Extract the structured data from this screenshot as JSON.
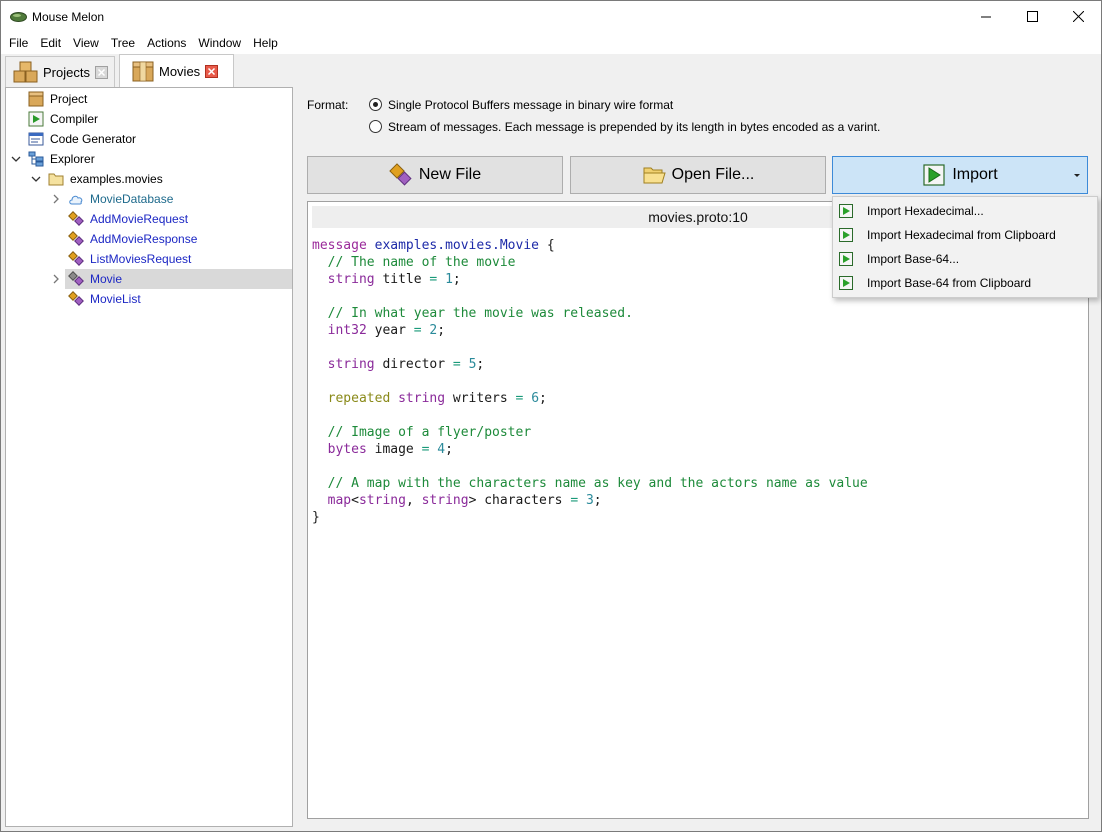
{
  "window": {
    "title": "Mouse Melon"
  },
  "menubar": {
    "items": [
      "File",
      "Edit",
      "View",
      "Tree",
      "Actions",
      "Window",
      "Help"
    ]
  },
  "tabs": [
    {
      "label": "Projects",
      "active": false
    },
    {
      "label": "Movies",
      "active": true
    }
  ],
  "tree": {
    "items": [
      {
        "label": "Project",
        "icon": "project-icon",
        "level": 0
      },
      {
        "label": "Compiler",
        "icon": "compiler-icon",
        "level": 0
      },
      {
        "label": "Code Generator",
        "icon": "code-generator-icon",
        "level": 0
      },
      {
        "label": "Explorer",
        "icon": "explorer-icon",
        "level": 0,
        "expanded": true
      },
      {
        "label": "examples.movies",
        "icon": "folder-icon",
        "level": 1,
        "expanded": true
      },
      {
        "label": "MovieDatabase",
        "icon": "cloud-service-icon",
        "level": 2,
        "collapsed": true
      },
      {
        "label": "AddMovieRequest",
        "icon": "message-icon",
        "level": 2
      },
      {
        "label": "AddMovieResponse",
        "icon": "message-icon",
        "level": 2
      },
      {
        "label": "ListMoviesRequest",
        "icon": "message-icon",
        "level": 2
      },
      {
        "label": "Movie",
        "icon": "message-icon",
        "level": 2,
        "collapsed": true,
        "selected": true
      },
      {
        "label": "MovieList",
        "icon": "message-icon",
        "level": 2
      }
    ]
  },
  "format": {
    "label": "Format:",
    "options": [
      {
        "label": "Single Protocol Buffers message in binary wire format",
        "checked": true
      },
      {
        "label": "Stream of messages. Each message is prepended by its length in bytes encoded as a varint.",
        "checked": false
      }
    ]
  },
  "buttons": {
    "new_file": "New File",
    "open_file": "Open File...",
    "import": "Import"
  },
  "editor": {
    "header": "movies.proto:10"
  },
  "import_menu": {
    "items": [
      "Import Hexadecimal...",
      "Import Hexadecimal from Clipboard",
      "Import Base-64...",
      "Import Base-64 from Clipboard"
    ]
  },
  "colors": {
    "link": "#1c27c4",
    "selection": "#d9d9d9",
    "primary_button": "#cce4f7",
    "comment": "#1d8a3a",
    "keyword": "#9a2a9a"
  }
}
